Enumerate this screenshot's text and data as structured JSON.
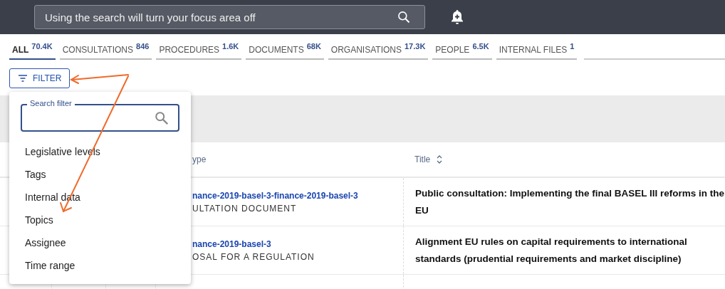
{
  "top_bar": {
    "search": {
      "placeholder": "Using the search will turn your focus area off"
    }
  },
  "tabs": [
    {
      "label": "ALL",
      "count": "70.4K",
      "selected": true
    },
    {
      "label": "CONSULTATIONS",
      "count": "846",
      "selected": false
    },
    {
      "label": "PROCEDURES",
      "count": "1.6K",
      "selected": false
    },
    {
      "label": "DOCUMENTS",
      "count": "68K",
      "selected": false
    },
    {
      "label": "ORGANISATIONS",
      "count": "17.3K",
      "selected": false
    },
    {
      "label": "PEOPLE",
      "count": "6.5K",
      "selected": false
    },
    {
      "label": "INTERNAL FILES",
      "count": "1",
      "selected": false
    }
  ],
  "filter_button": {
    "label": "FILTER"
  },
  "filter_menu": {
    "search": {
      "label": "Search filter"
    },
    "items": [
      "Legislative levels",
      "Tags",
      "Internal data",
      "Topics",
      "Assignee",
      "Time range"
    ]
  },
  "table": {
    "columns": [
      "ype",
      "Title"
    ],
    "rows": [
      {
        "link": "nance-2019-basel-3-finance-2019-basel-3",
        "type": "ULTATION DOCUMENT",
        "title": "Public consultation: Implementing the final BASEL III reforms in the EU"
      },
      {
        "link": "nance-2019-basel-3",
        "type": "OSAL FOR A REGULATION",
        "title": "Alignment EU rules on capital requirements to international standards (prudential requirements and market discipline)"
      }
    ]
  }
}
